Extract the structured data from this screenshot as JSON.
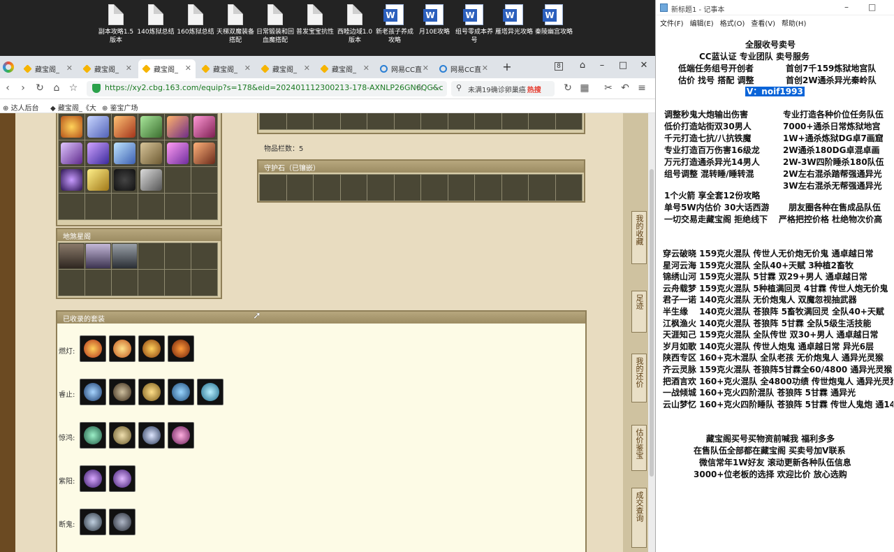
{
  "desktop": {
    "icons": [
      {
        "label": "副本攻略1.5版本",
        "kind": "file"
      },
      {
        "label": "140炼狱总结",
        "kind": "file"
      },
      {
        "label": "160炼狱总结",
        "kind": "file"
      },
      {
        "label": "天梯双魔装备搭配",
        "kind": "file"
      },
      {
        "label": "日常锻装和回血魔搭配",
        "kind": "file"
      },
      {
        "label": "普发宝宝抗性",
        "kind": "file"
      },
      {
        "label": "西睦边域1.0版本",
        "kind": "file"
      },
      {
        "label": "新老孩子养成攻略",
        "kind": "word"
      },
      {
        "label": "月10E攻略",
        "kind": "word"
      },
      {
        "label": "组号零成本养号",
        "kind": "word"
      },
      {
        "label": "雁塔异光攻略",
        "kind": "word"
      },
      {
        "label": "秦陵幽宫攻略",
        "kind": "word"
      }
    ]
  },
  "browser": {
    "tabs": [
      {
        "label": "藏宝阁_",
        "icon": "cbg",
        "active": false
      },
      {
        "label": "藏宝阁_",
        "icon": "cbg",
        "active": false
      },
      {
        "label": "藏宝阁_",
        "icon": "cbg",
        "active": true
      },
      {
        "label": "藏宝阁_",
        "icon": "cbg",
        "active": false
      },
      {
        "label": "藏宝阁_",
        "icon": "cbg",
        "active": false
      },
      {
        "label": "藏宝阁_",
        "icon": "cbg",
        "active": false
      },
      {
        "label": "网易CC直",
        "icon": "ne",
        "active": false
      },
      {
        "label": "网易CC直",
        "icon": "ne",
        "active": false
      }
    ],
    "tab_count_badge": "8",
    "url": "https://xy2.cbg.163.com/equip?s=178&eid=202401112300213-178-AXNLP26GN6QG&c",
    "search_text": "未满19确诊卵巢癌",
    "search_hot": "热搜",
    "bookmarks": [
      "达人后台",
      "藏宝阁_《大",
      "鉴宝广场"
    ]
  },
  "page": {
    "item_count_label": "物品栏数：5",
    "guard_stone_label": "守护石（已镶嵌）",
    "inventory_top_label": "",
    "beast_section_label": "地煞星阁",
    "collected_sets_label": "已收录的套装",
    "sets": [
      {
        "name": "燃灯:",
        "count": 4
      },
      {
        "name": "睿止:",
        "count": 5
      },
      {
        "name": "惊鸿:",
        "count": 4
      },
      {
        "name": "紫阳:",
        "count": 2
      },
      {
        "name": "断鬼:",
        "count": 2
      }
    ],
    "side_buttons": [
      "我的收藏",
      "足迹",
      "我的还价",
      "估价鉴宝",
      "成交查询"
    ]
  },
  "notepad": {
    "title": "新标题1 - 记事本",
    "menu": [
      "文件(F)",
      "编辑(E)",
      "格式(O)",
      "查看(V)",
      "帮助(H)"
    ],
    "header_lines": [
      "全服收号卖号",
      "CC蓝认证 专业团队 卖号服务",
      "低端任务组号开创者",
      "首创7千159炼狱地宫队",
      "估价 找号 搭配 调整",
      "首创2W通杀异光秦岭队"
    ],
    "contact": "V：noif1993",
    "service_left": [
      "调整秒鬼大炮输出伤害",
      "低价打造站街双30男人",
      "千元打造七抗/八抗铁魔",
      "专业打造百万伤害16级龙",
      "万元打造通杀异光14男人",
      "组号调整 混转睡/睡转混"
    ],
    "service_right": [
      "专业打造各种价位任务队伍",
      "7000+通杀日常炼狱地宫",
      "1W+通杀炼狱DG卓7画窟",
      "2W通杀180DG卓混卓画",
      "2W-3W四阶睡杀180队伍",
      "2W左右混杀踏帮强通异光",
      "3W左右混杀无帮强通异光"
    ],
    "mid_lines": [
      "1个火箭 享全套12份攻略",
      "单号5W内估价 30大话西游",
      "朋友圈各种在售成品队伍",
      "一切交易走藏宝阁 拒绝线下",
      "严格把控价格 杜绝物次价高"
    ],
    "teams": [
      "穿云破晓 159克火混队 传世人无价炮无价鬼 通卓越日常",
      "星河云海 159克火混队 全队40+天赋 3种植2畜牧",
      "锦绣山河 159克火混队 5甘霖 双29+男人 通卓越日常",
      "云舟载梦 159克火混队 5种植满回灵 4甘霖 传世人炮无价鬼",
      "君子一诺 140克火混队 无价炮鬼人 双魔忽视抽武器",
      "半生缘　 140克火混队 苍狼阵 5畜牧满回灵 全队40+天赋",
      "江枫渔火 140克火混队 苍狼阵 5甘霖 全队5级生活技能",
      "天涯知己 159克火混队 全队传世 双30+男人 通卓越日常",
      "岁月如歌 140克火混队 传世人炮鬼 通卓越日常 异光6层",
      "陕西专区 160+克木混队 全队老孩 无价炮鬼人 通异光灵猴",
      "齐云灵脉 159克火混队 苍狼阵5甘霖全60/4800 通异光灵猴",
      "把酒言欢 160+克火混队 全4800功绩 传世炮鬼人 通异光灵猴",
      "一战倾城 160+克火四阶混队 苍狼阵 5甘霖 通异光",
      "云山梦忆 160+克火四阶睡队 苍狼阵 5甘霖 传世人鬼炮 通14"
    ],
    "footer_lines": [
      "藏宝阁买号买物资前喊我 福利多多",
      "在售队伍全部都在藏宝阁 买卖号加V联系",
      "微信常年1W好友 滚动更新各种队伍信息",
      "3000+位老板的选择 欢迎比价 放心选购"
    ]
  }
}
